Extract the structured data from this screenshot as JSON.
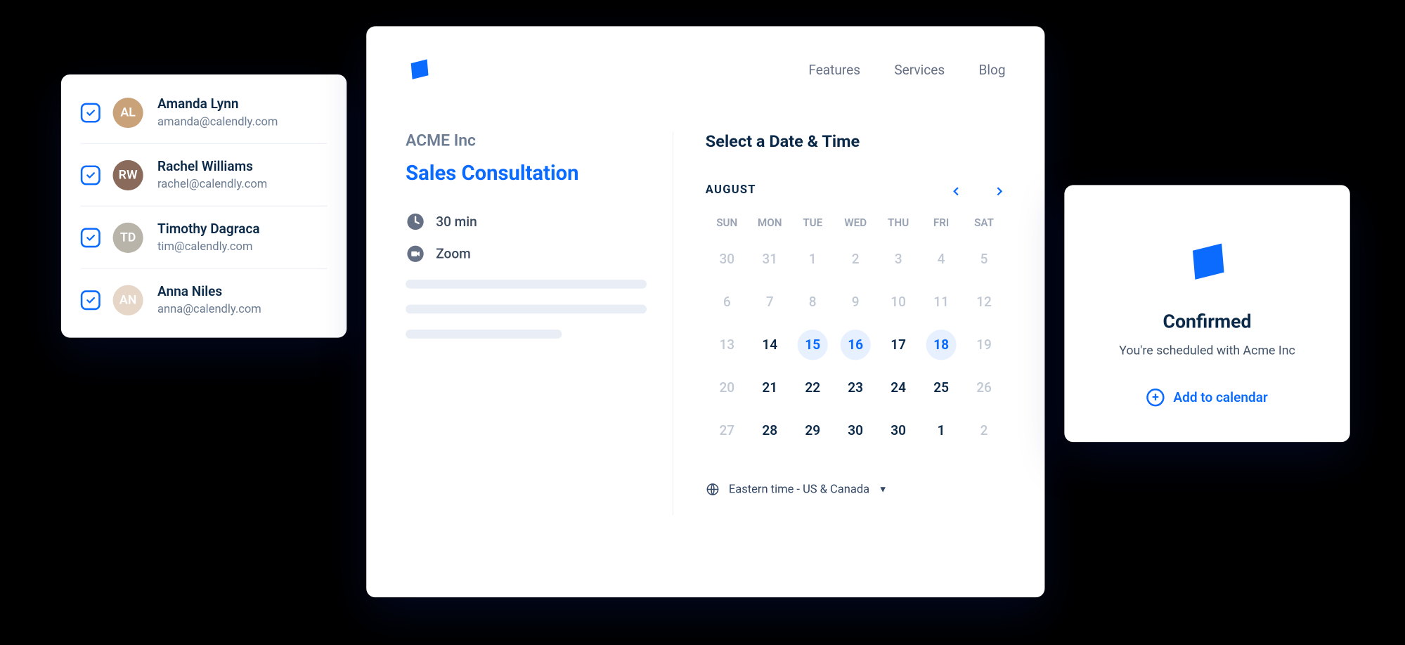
{
  "team": [
    {
      "name": "Amanda Lynn",
      "email": "amanda@calendly.com",
      "color": "#caa27a"
    },
    {
      "name": "Rachel Williams",
      "email": "rachel@calendly.com",
      "color": "#8a6a5a"
    },
    {
      "name": "Timothy Dagraca",
      "email": "tim@calendly.com",
      "color": "#b8b4aa"
    },
    {
      "name": "Anna Niles",
      "email": "anna@calendly.com",
      "color": "#e6d6c8"
    }
  ],
  "nav": {
    "features": "Features",
    "services": "Services",
    "blog": "Blog"
  },
  "booking": {
    "company": "ACME Inc",
    "title": "Sales Consultation",
    "duration": "30 min",
    "location": "Zoom"
  },
  "calendar": {
    "heading": "Select a Date & Time",
    "month": "AUGUST",
    "dow": [
      "SUN",
      "MON",
      "TUE",
      "WED",
      "THU",
      "FRI",
      "SAT"
    ],
    "weeks": [
      [
        {
          "n": "30",
          "muted": true
        },
        {
          "n": "31",
          "muted": true
        },
        {
          "n": "1",
          "muted": true
        },
        {
          "n": "2",
          "muted": true
        },
        {
          "n": "3",
          "muted": true
        },
        {
          "n": "4",
          "muted": true
        },
        {
          "n": "5",
          "muted": true
        }
      ],
      [
        {
          "n": "6",
          "muted": true
        },
        {
          "n": "7",
          "muted": true
        },
        {
          "n": "8",
          "muted": true
        },
        {
          "n": "9",
          "muted": true
        },
        {
          "n": "10",
          "muted": true
        },
        {
          "n": "11",
          "muted": true
        },
        {
          "n": "12",
          "muted": true
        }
      ],
      [
        {
          "n": "13",
          "muted": true
        },
        {
          "n": "14"
        },
        {
          "n": "15",
          "hl": true
        },
        {
          "n": "16",
          "hl": true
        },
        {
          "n": "17"
        },
        {
          "n": "18",
          "hl": true
        },
        {
          "n": "19",
          "muted": true
        }
      ],
      [
        {
          "n": "20",
          "muted": true
        },
        {
          "n": "21"
        },
        {
          "n": "22"
        },
        {
          "n": "23"
        },
        {
          "n": "24"
        },
        {
          "n": "25"
        },
        {
          "n": "26",
          "muted": true
        }
      ],
      [
        {
          "n": "27",
          "muted": true
        },
        {
          "n": "28"
        },
        {
          "n": "29"
        },
        {
          "n": "30"
        },
        {
          "n": "30"
        },
        {
          "n": "1"
        },
        {
          "n": "2",
          "muted": true
        }
      ]
    ],
    "timezone": "Eastern time - US & Canada"
  },
  "confirm": {
    "title": "Confirmed",
    "subtitle": "You're scheduled with Acme Inc",
    "addCal": "Add to calendar"
  }
}
